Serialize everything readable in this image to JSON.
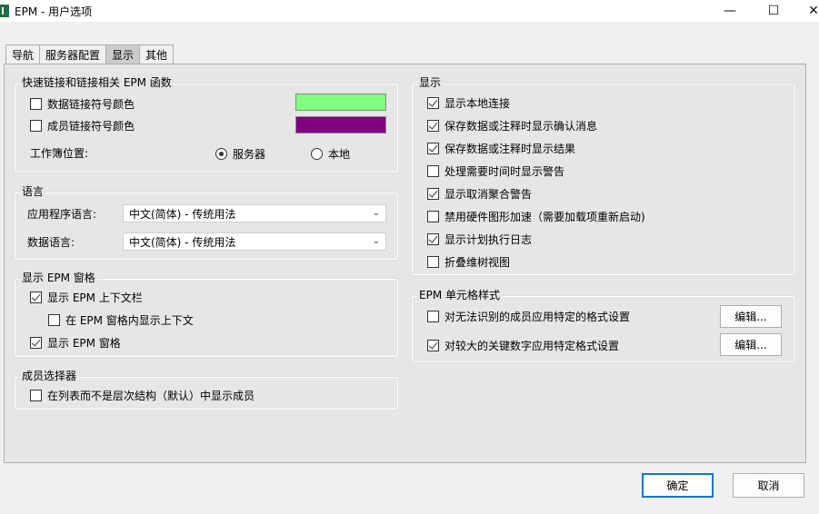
{
  "window": {
    "title": "EPM - 用户选项",
    "minimize": "—",
    "maximize": "☐",
    "close": "✕"
  },
  "tabs": [
    {
      "label": "导航"
    },
    {
      "label": "服务器配置"
    },
    {
      "label": "显示",
      "active": true
    },
    {
      "label": "其他"
    }
  ],
  "quicklink": {
    "title": "快速链接和链接相关 EPM 函数",
    "data_link_color_label": "数据链接符号颜色",
    "data_link_color": "#80ff80",
    "data_link_checked": false,
    "member_link_color_label": "成员链接符号颜色",
    "member_link_color": "#800080",
    "member_link_checked": false,
    "workbook_location_label": "工作簿位置:",
    "location_server": "服务器",
    "location_local": "本地",
    "location_selected": "server"
  },
  "language": {
    "title": "语言",
    "app_language_label": "应用程序语言:",
    "app_language_value": "中文(简体) - 传统用法",
    "data_language_label": "数据语言:",
    "data_language_value": "中文(简体) - 传统用法"
  },
  "epm_pane": {
    "title": "显示 EPM 窗格",
    "show_context_bar": "显示 EPM 上下文栏",
    "show_context_bar_checked": true,
    "show_context_in_pane": "在 EPM 窗格内显示上下文",
    "show_context_in_pane_checked": false,
    "show_pane": "显示 EPM 窗格",
    "show_pane_checked": true
  },
  "member_selector": {
    "title": "成员选择器",
    "list_view": "在列表而不是层次结构（默认）中显示成员",
    "list_view_checked": false
  },
  "display": {
    "title": "显示",
    "items": [
      {
        "label": "显示本地连接",
        "checked": true
      },
      {
        "label": "保存数据或注释时显示确认消息",
        "checked": true
      },
      {
        "label": "保存数据或注释时显示结果",
        "checked": true
      },
      {
        "label": "处理需要时间时显示警告",
        "checked": false
      },
      {
        "label": "显示取消聚合警告",
        "checked": true
      },
      {
        "label": "禁用硬件图形加速（需要加载项重新启动)",
        "checked": false
      },
      {
        "label": "显示计划执行日志",
        "checked": true
      },
      {
        "label": "折叠维树视图",
        "checked": false
      }
    ]
  },
  "cell_styles": {
    "title": "EPM 单元格样式",
    "unrecognized_member": "对无法识别的成员应用特定的格式设置",
    "unrecognized_member_checked": false,
    "larger_key_figure": "对较大的关键数字应用特定格式设置",
    "larger_key_figure_checked": true,
    "edit_label": "编辑..."
  },
  "footer": {
    "ok": "确定",
    "cancel": "取消"
  }
}
